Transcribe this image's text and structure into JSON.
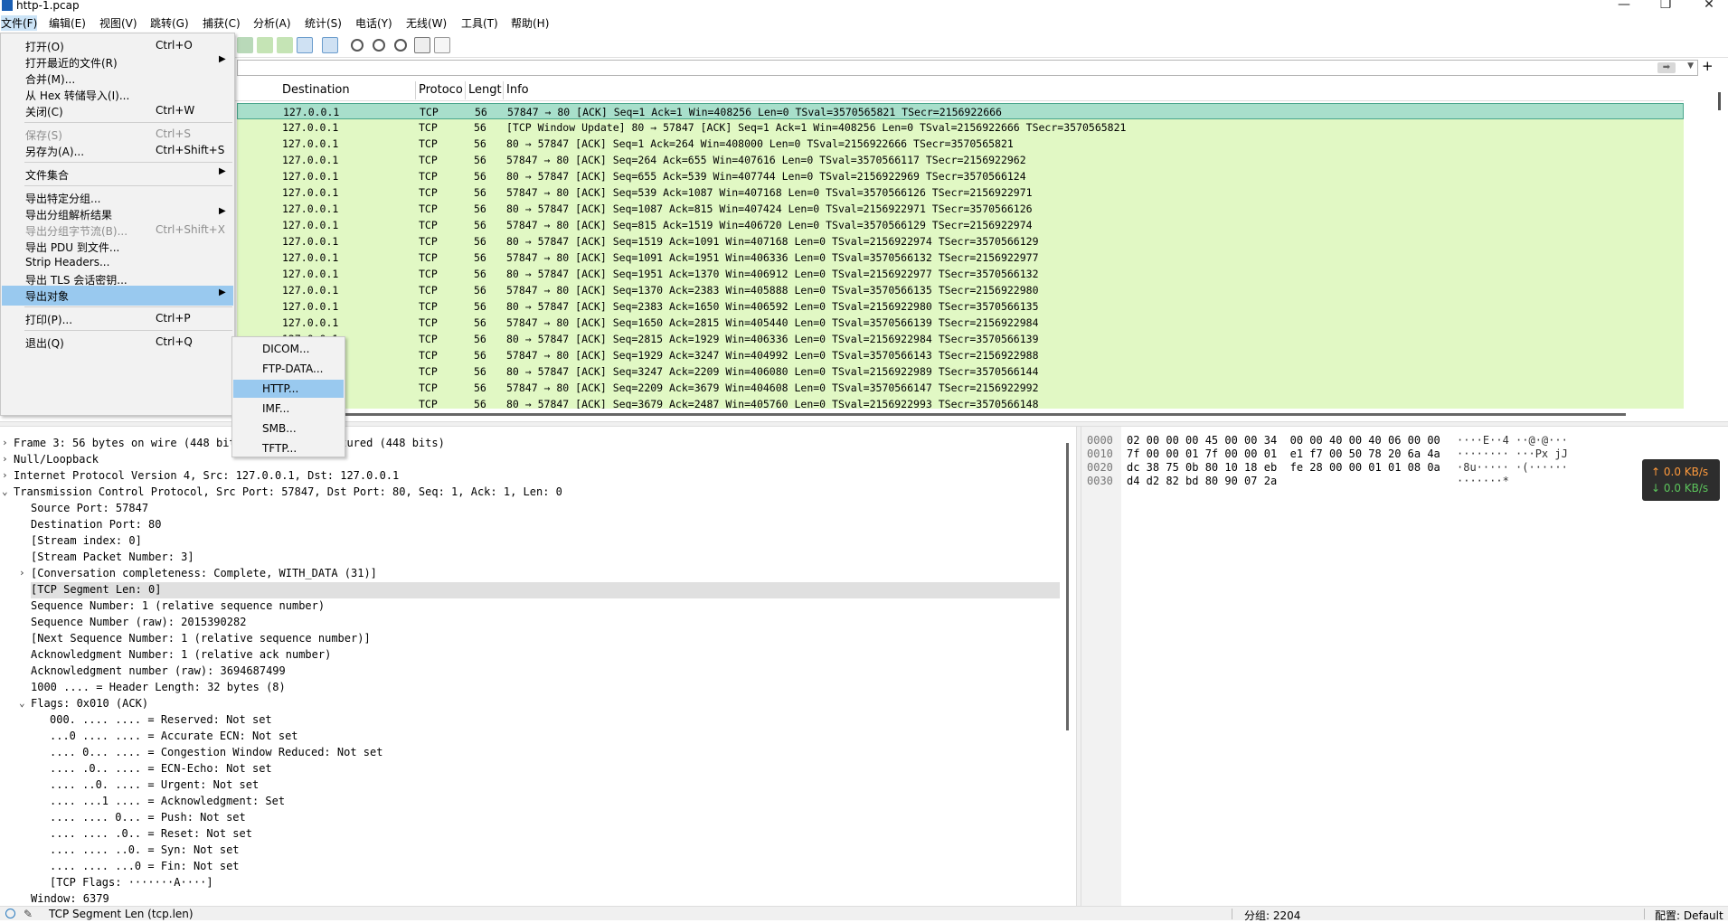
{
  "window": {
    "title": "http-1.pcap"
  },
  "menubar": [
    "文件(F)",
    "编辑(E)",
    "视图(V)",
    "跳转(G)",
    "捕获(C)",
    "分析(A)",
    "统计(S)",
    "电话(Y)",
    "无线(W)",
    "工具(T)",
    "帮助(H)"
  ],
  "file_menu": [
    {
      "label": "打开(O)",
      "shortcut": "Ctrl+O"
    },
    {
      "label": "打开最近的文件(R)",
      "shortcut": ""
    },
    {
      "label": "合并(M)...",
      "shortcut": ""
    },
    {
      "label": "从 Hex 转储导入(I)...",
      "shortcut": ""
    },
    {
      "label": "关闭(C)",
      "shortcut": "Ctrl+W"
    },
    {
      "label": "保存(S)",
      "shortcut": "Ctrl+S"
    },
    {
      "label": "另存为(A)...",
      "shortcut": "Ctrl+Shift+S"
    },
    {
      "label": "文件集合",
      "shortcut": ""
    },
    {
      "label": "导出特定分组...",
      "shortcut": ""
    },
    {
      "label": "导出分组解析结果",
      "shortcut": ""
    },
    {
      "label": "导出分组字节流(B)...",
      "shortcut": "Ctrl+Shift+X"
    },
    {
      "label": "导出 PDU 到文件...",
      "shortcut": ""
    },
    {
      "label": "Strip Headers...",
      "shortcut": ""
    },
    {
      "label": "导出 TLS 会话密钥...",
      "shortcut": ""
    },
    {
      "label": "导出对象",
      "shortcut": ""
    },
    {
      "label": "打印(P)...",
      "shortcut": "Ctrl+P"
    },
    {
      "label": "退出(Q)",
      "shortcut": "Ctrl+Q"
    }
  ],
  "export_objects_menu": [
    "DICOM...",
    "FTP-DATA...",
    "HTTP...",
    "IMF...",
    "SMB...",
    "TFTP..."
  ],
  "packet_list": {
    "columns": [
      "Destination",
      "Protoco",
      "Lengt",
      "Info"
    ],
    "rows": [
      {
        "dst": "127.0.0.1",
        "proto": "TCP",
        "len": "56",
        "info": "57847 → 80 [ACK] Seq=1 Ack=1 Win=408256 Len=0 TSval=3570565821 TSecr=2156922666"
      },
      {
        "dst": "127.0.0.1",
        "proto": "TCP",
        "len": "56",
        "info": "[TCP Window Update] 80 → 57847 [ACK] Seq=1 Ack=1 Win=408256 Len=0 TSval=2156922666 TSecr=3570565821"
      },
      {
        "dst": "127.0.0.1",
        "proto": "TCP",
        "len": "56",
        "info": "80 → 57847 [ACK] Seq=1 Ack=264 Win=408000 Len=0 TSval=2156922666 TSecr=3570565821"
      },
      {
        "dst": "127.0.0.1",
        "proto": "TCP",
        "len": "56",
        "info": "57847 → 80 [ACK] Seq=264 Ack=655 Win=407616 Len=0 TSval=3570566117 TSecr=2156922962"
      },
      {
        "dst": "127.0.0.1",
        "proto": "TCP",
        "len": "56",
        "info": "80 → 57847 [ACK] Seq=655 Ack=539 Win=407744 Len=0 TSval=2156922969 TSecr=3570566124"
      },
      {
        "dst": "127.0.0.1",
        "proto": "TCP",
        "len": "56",
        "info": "57847 → 80 [ACK] Seq=539 Ack=1087 Win=407168 Len=0 TSval=3570566126 TSecr=2156922971"
      },
      {
        "dst": "127.0.0.1",
        "proto": "TCP",
        "len": "56",
        "info": "80 → 57847 [ACK] Seq=1087 Ack=815 Win=407424 Len=0 TSval=2156922971 TSecr=3570566126"
      },
      {
        "dst": "127.0.0.1",
        "proto": "TCP",
        "len": "56",
        "info": "57847 → 80 [ACK] Seq=815 Ack=1519 Win=406720 Len=0 TSval=3570566129 TSecr=2156922974"
      },
      {
        "dst": "127.0.0.1",
        "proto": "TCP",
        "len": "56",
        "info": "80 → 57847 [ACK] Seq=1519 Ack=1091 Win=407168 Len=0 TSval=2156922974 TSecr=3570566129"
      },
      {
        "dst": "127.0.0.1",
        "proto": "TCP",
        "len": "56",
        "info": "57847 → 80 [ACK] Seq=1091 Ack=1951 Win=406336 Len=0 TSval=3570566132 TSecr=2156922977"
      },
      {
        "dst": "127.0.0.1",
        "proto": "TCP",
        "len": "56",
        "info": "80 → 57847 [ACK] Seq=1951 Ack=1370 Win=406912 Len=0 TSval=2156922977 TSecr=3570566132"
      },
      {
        "dst": "127.0.0.1",
        "proto": "TCP",
        "len": "56",
        "info": "57847 → 80 [ACK] Seq=1370 Ack=2383 Win=405888 Len=0 TSval=3570566135 TSecr=2156922980"
      },
      {
        "dst": "127.0.0.1",
        "proto": "TCP",
        "len": "56",
        "info": "80 → 57847 [ACK] Seq=2383 Ack=1650 Win=406592 Len=0 TSval=2156922980 TSecr=3570566135"
      },
      {
        "dst": "127.0.0.1",
        "proto": "TCP",
        "len": "56",
        "info": "57847 → 80 [ACK] Seq=1650 Ack=2815 Win=405440 Len=0 TSval=3570566139 TSecr=2156922984"
      },
      {
        "dst": "127.0.0.1",
        "proto": "TCP",
        "len": "56",
        "info": "80 → 57847 [ACK] Seq=2815 Ack=1929 Win=406336 Len=0 TSval=2156922984 TSecr=3570566139"
      },
      {
        "dst": "127.0.0.1",
        "proto": "TCP",
        "len": "56",
        "info": "57847 → 80 [ACK] Seq=1929 Ack=3247 Win=404992 Len=0 TSval=3570566143 TSecr=2156922988"
      },
      {
        "dst": "127.0.0.1",
        "proto": "TCP",
        "len": "56",
        "info": "80 → 57847 [ACK] Seq=3247 Ack=2209 Win=406080 Len=0 TSval=2156922989 TSecr=3570566144"
      },
      {
        "dst": "127.0.0.1",
        "proto": "TCP",
        "len": "56",
        "info": "57847 → 80 [ACK] Seq=2209 Ack=3679 Win=404608 Len=0 TSval=3570566147 TSecr=2156922992"
      },
      {
        "dst": "127.0.0.1",
        "proto": "TCP",
        "len": "56",
        "info": "80 → 57847 [ACK] Seq=3679 Ack=2487 Win=405760 Len=0 TSval=2156922993 TSecr=3570566148"
      }
    ],
    "row_color": "#e1f8c4",
    "selected_color": "#a8dfcb"
  },
  "details": [
    {
      "text": "Frame 3: 56 bytes on wire (448 bits), 56 bytes captured (448 bits)",
      "arrow": "›"
    },
    {
      "text": "Null/Loopback",
      "arrow": "›"
    },
    {
      "text": "Internet Protocol Version 4, Src: 127.0.0.1, Dst: 127.0.0.1",
      "arrow": "›"
    },
    {
      "text": "Transmission Control Protocol, Src Port: 57847, Dst Port: 80, Seq: 1, Ack: 1, Len: 0",
      "arrow": "⌄"
    },
    {
      "text": "Source Port: 57847",
      "arrow": ""
    },
    {
      "text": "Destination Port: 80",
      "arrow": ""
    },
    {
      "text": "[Stream index: 0]",
      "arrow": ""
    },
    {
      "text": "[Stream Packet Number: 3]",
      "arrow": ""
    },
    {
      "text": "[Conversation completeness: Complete, WITH_DATA (31)]",
      "arrow": "›"
    },
    {
      "text": "[TCP Segment Len: 0]",
      "arrow": ""
    },
    {
      "text": "Sequence Number: 1    (relative sequence number)",
      "arrow": ""
    },
    {
      "text": "Sequence Number (raw): 2015390282",
      "arrow": ""
    },
    {
      "text": "[Next Sequence Number: 1    (relative sequence number)]",
      "arrow": ""
    },
    {
      "text": "Acknowledgment Number: 1    (relative ack number)",
      "arrow": ""
    },
    {
      "text": "Acknowledgment number (raw): 3694687499",
      "arrow": ""
    },
    {
      "text": "1000 .... = Header Length: 32 bytes (8)",
      "arrow": ""
    },
    {
      "text": "Flags: 0x010 (ACK)",
      "arrow": "⌄"
    },
    {
      "text": "000. .... .... = Reserved: Not set",
      "arrow": ""
    },
    {
      "text": "...0 .... .... = Accurate ECN: Not set",
      "arrow": ""
    },
    {
      "text": ".... 0... .... = Congestion Window Reduced: Not set",
      "arrow": ""
    },
    {
      "text": ".... .0.. .... = ECN-Echo: Not set",
      "arrow": ""
    },
    {
      "text": ".... ..0. .... = Urgent: Not set",
      "arrow": ""
    },
    {
      "text": ".... ...1 .... = Acknowledgment: Set",
      "arrow": ""
    },
    {
      "text": ".... .... 0... = Push: Not set",
      "arrow": ""
    },
    {
      "text": ".... .... .0.. = Reset: Not set",
      "arrow": ""
    },
    {
      "text": ".... .... ..0. = Syn: Not set",
      "arrow": ""
    },
    {
      "text": ".... .... ...0 = Fin: Not set",
      "arrow": ""
    },
    {
      "text": "[TCP Flags: ·······A····]",
      "arrow": ""
    },
    {
      "text": "Window: 6379",
      "arrow": ""
    }
  ],
  "bytes": [
    {
      "offset": "0000",
      "hex": "02 00 00 00 45 00 00 34  00 00 40 00 40 06 00 00",
      "ascii": "····E··4 ··@·@···"
    },
    {
      "offset": "0010",
      "hex": "7f 00 00 01 7f 00 00 01  e1 f7 00 50 78 20 6a 4a",
      "ascii": "········ ···Px jJ"
    },
    {
      "offset": "0020",
      "hex": "dc 38 75 0b 80 10 18 eb  fe 28 00 00 01 01 08 0a",
      "ascii": "·8u····· ·(······"
    },
    {
      "offset": "0030",
      "hex": "d4 d2 82 bd 80 90 07 2a",
      "ascii": "·······*"
    }
  ],
  "netspeed": {
    "up": "↑ 0.0 KB/s",
    "down": "↓ 0.0 KB/s"
  },
  "statusbar": {
    "field": "TCP Segment Len (tcp.len)",
    "packets": "分组: 2204",
    "profile": "配置: Default"
  }
}
